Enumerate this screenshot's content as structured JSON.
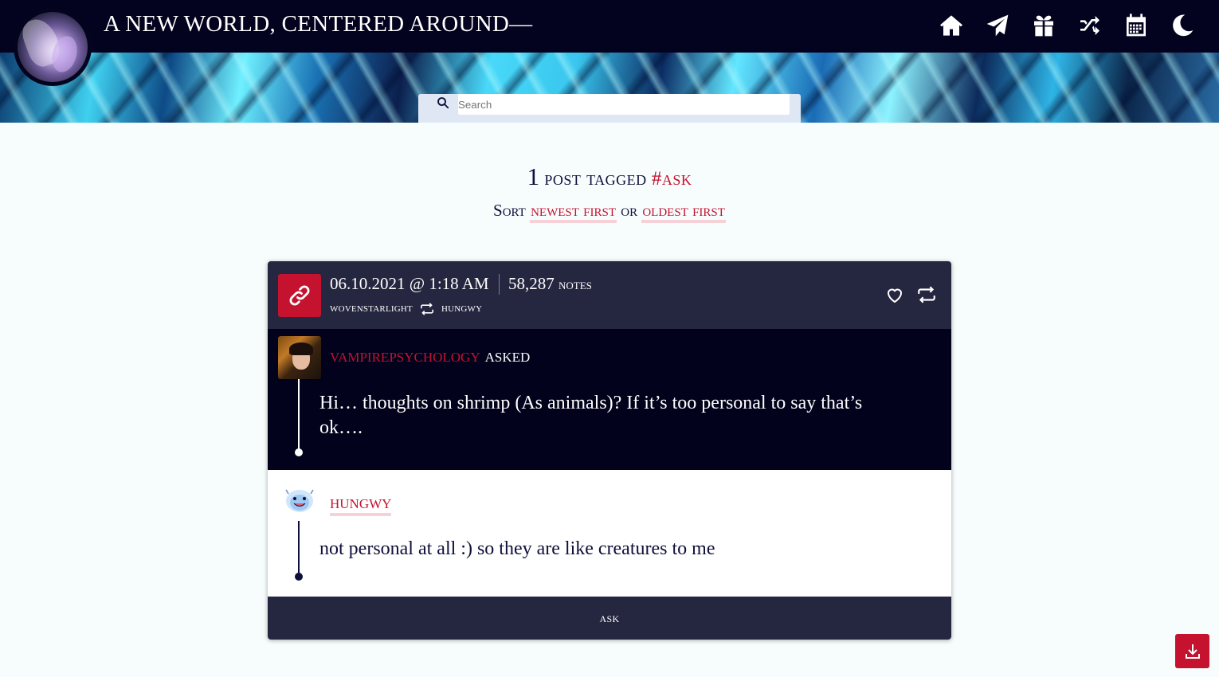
{
  "site": {
    "title": "A NEW WORLD, CENTERED AROUND—"
  },
  "nav": {
    "items": [
      "home-icon",
      "paper-plane-icon",
      "gift-icon",
      "shuffle-icon",
      "calendar-icon",
      "moon-icon"
    ]
  },
  "search": {
    "placeholder": "Search"
  },
  "tagged": {
    "count": "1",
    "label": "post tagged",
    "tag": "#ask"
  },
  "sort": {
    "label": "Sort",
    "newest": "newest first",
    "or": "or",
    "oldest": "oldest first"
  },
  "post": {
    "type_icon": "link-icon",
    "date": "06.10.2021 @ 1:18 AM",
    "notes_count": "58,287",
    "notes_label": "notes",
    "reblogged_from": "wovenstarlight",
    "original_poster": "hungwy",
    "ask": {
      "asker": "vampirepsychology",
      "asked_label": "asked",
      "question": "Hi… thoughts on shrimp (As animals)? If it’s too personal to say that’s ok…."
    },
    "answer": {
      "answerer": "hungwy",
      "text": "not personal at all :) so they are like creatures to me"
    },
    "tags": [
      "ask"
    ]
  },
  "colors": {
    "accent": "#c4122f",
    "topbar": "#03031f",
    "post_header": "#25263f",
    "ask_bg": "#02021c",
    "page_bg": "#f7fdfd"
  }
}
